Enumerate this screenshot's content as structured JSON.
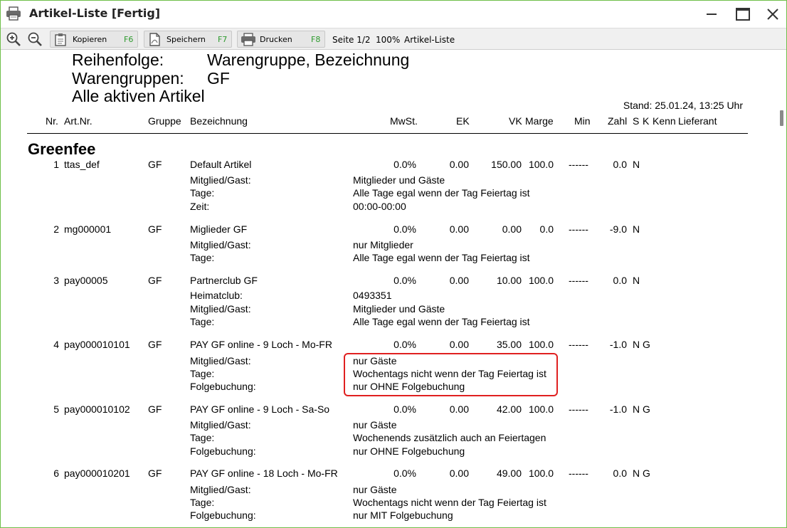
{
  "window": {
    "title": "Artikel-Liste [Fertig]",
    "accent_color": "#6fbf4a"
  },
  "toolbar": {
    "zoom_in_icon": "zoom-in-icon",
    "zoom_out_icon": "zoom-out-icon",
    "copy_label": "Kopieren",
    "copy_key": "F6",
    "save_label": "Speichern",
    "save_key": "F7",
    "print_label": "Drucken",
    "print_key": "F8",
    "page_info": "Seite 1/2",
    "zoom_level": "100%",
    "report_name": "Artikel-Liste",
    "key_color": "#2d9a2d"
  },
  "report": {
    "order_label": "Reihenfolge:",
    "order_value": "Warengruppe, Bezeichnung",
    "groups_label": "Warengruppen:",
    "groups_value": "GF",
    "filter_text": "Alle aktiven Artikel",
    "stand": "Stand: 25.01.24, 13:25 Uhr",
    "columns": {
      "nr": "Nr.",
      "artnr": "Art.Nr.",
      "gruppe": "Gruppe",
      "bez": "Bezeichnung",
      "mwst": "MwSt.",
      "ek": "EK",
      "vk": "VK",
      "marge": "Marge",
      "min": "Min",
      "zahl": "Zahl",
      "s": "S",
      "k": "K",
      "kenn": "Kenn",
      "lieferant": "Lieferant"
    },
    "group_name": "Greenfee",
    "items": [
      {
        "nr": "1",
        "artnr": "ttas_def",
        "gruppe": "GF",
        "bez": "Default Artikel",
        "mwst": "0.0%",
        "ek": "0.00",
        "vk": "150.00",
        "marge": "100.0",
        "min": "------",
        "zahl": "0.0",
        "s": "N",
        "k": "",
        "details": [
          {
            "label": "Mitglied/Gast:",
            "value": "Mitglieder und Gäste"
          },
          {
            "label": "Tage:",
            "value": "Alle Tage egal wenn der Tag Feiertag ist"
          },
          {
            "label": "Zeit:",
            "value": "00:00-00:00"
          }
        ]
      },
      {
        "nr": "2",
        "artnr": "mg000001",
        "gruppe": "GF",
        "bez": "Miglieder GF",
        "mwst": "0.0%",
        "ek": "0.00",
        "vk": "0.00",
        "marge": "0.0",
        "min": "------",
        "zahl": "-9.0",
        "s": "N",
        "k": "",
        "details": [
          {
            "label": "Mitglied/Gast:",
            "value": "nur Mitglieder"
          },
          {
            "label": "Tage:",
            "value": "Alle Tage egal wenn der Tag Feiertag ist"
          }
        ]
      },
      {
        "nr": "3",
        "artnr": "pay00005",
        "gruppe": "GF",
        "bez": "Partnerclub GF",
        "mwst": "0.0%",
        "ek": "0.00",
        "vk": "10.00",
        "marge": "100.0",
        "min": "------",
        "zahl": "0.0",
        "s": "N",
        "k": "",
        "details": [
          {
            "label": "Heimatclub:",
            "value": "0493351"
          },
          {
            "label": "Mitglied/Gast:",
            "value": "Mitglieder und Gäste"
          },
          {
            "label": "Tage:",
            "value": "Alle Tage egal wenn der Tag Feiertag ist"
          }
        ]
      },
      {
        "nr": "4",
        "artnr": "pay000010101",
        "gruppe": "GF",
        "bez": "PAY GF  online - 9 Loch - Mo-FR",
        "mwst": "0.0%",
        "ek": "0.00",
        "vk": "35.00",
        "marge": "100.0",
        "min": "------",
        "zahl": "-1.0",
        "s": "N",
        "k": "G",
        "details": [
          {
            "label": "Mitglied/Gast:",
            "value": "nur Gäste"
          },
          {
            "label": "Tage:",
            "value": "Wochentags nicht wenn der Tag Feiertag ist"
          },
          {
            "label": "Folgebuchung:",
            "value": "nur OHNE Folgebuchung"
          }
        ]
      },
      {
        "nr": "5",
        "artnr": "pay000010102",
        "gruppe": "GF",
        "bez": "PAY GF  online - 9 Loch - Sa-So",
        "mwst": "0.0%",
        "ek": "0.00",
        "vk": "42.00",
        "marge": "100.0",
        "min": "------",
        "zahl": "-1.0",
        "s": "N",
        "k": "G",
        "details": [
          {
            "label": "Mitglied/Gast:",
            "value": "nur Gäste"
          },
          {
            "label": "Tage:",
            "value": "Wochenends zusätzlich auch an Feiertagen"
          },
          {
            "label": "Folgebuchung:",
            "value": "nur OHNE Folgebuchung"
          }
        ]
      },
      {
        "nr": "6",
        "artnr": "pay000010201",
        "gruppe": "GF",
        "bez": "PAY GF  online - 18 Loch - Mo-FR",
        "mwst": "0.0%",
        "ek": "0.00",
        "vk": "49.00",
        "marge": "100.0",
        "min": "------",
        "zahl": "0.0",
        "s": "N",
        "k": "G",
        "details": [
          {
            "label": "Mitglied/Gast:",
            "value": "nur Gäste"
          },
          {
            "label": "Tage:",
            "value": "Wochentags nicht wenn der Tag Feiertag ist"
          },
          {
            "label": "Folgebuchung:",
            "value": "nur MIT Folgebuchung"
          }
        ]
      }
    ],
    "highlight_color": "#e02020"
  }
}
